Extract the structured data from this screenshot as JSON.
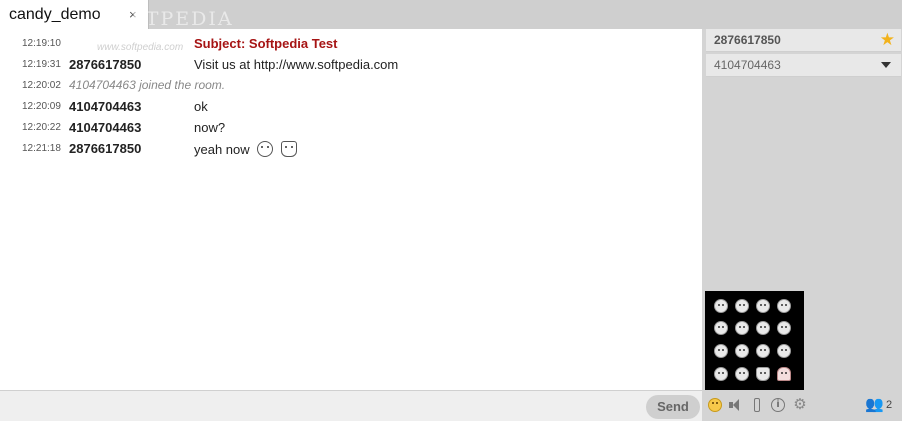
{
  "tab": {
    "label": "candy_demo",
    "close": "×",
    "watermark": "SOFTPEDIA"
  },
  "messages": [
    {
      "time": "12:19:10",
      "kind": "subject",
      "user": "",
      "text": "Subject: Softpedia Test",
      "watermark": "www.softpedia.com"
    },
    {
      "time": "12:19:31",
      "kind": "message",
      "user": "2876617850",
      "text": "Visit us at http://www.softpedia.com"
    },
    {
      "time": "12:20:02",
      "kind": "info",
      "user": "",
      "text": "4104704463 joined the room."
    },
    {
      "time": "12:20:09",
      "kind": "message",
      "user": "4104704463",
      "text": "ok"
    },
    {
      "time": "12:20:22",
      "kind": "message",
      "user": "4104704463",
      "text": "now?"
    },
    {
      "time": "12:21:18",
      "kind": "message",
      "user": "2876617850",
      "text": "yeah now",
      "emoticons": [
        "smile-icon",
        "cat-icon"
      ]
    }
  ],
  "input": {
    "send_label": "Send"
  },
  "roster": [
    {
      "name": "2876617850",
      "icon": "star-icon",
      "color": "#f2b21b"
    },
    {
      "name": "4104704463",
      "icon": "caret-down-icon"
    }
  ],
  "toolbar": {
    "icons": [
      "emoticons-icon",
      "sound-icon",
      "autoscroll-icon",
      "status-message-icon",
      "settings-icon",
      "users-icon"
    ],
    "user_count": "2"
  },
  "emoticon_picker": {
    "icons": [
      "smile-icon",
      "wink-icon",
      "grin-icon",
      "happy-icon",
      "sad-icon",
      "angry-icon",
      "surprised-icon",
      "tongue-icon",
      "neutral-icon",
      "laugh-icon",
      "cool-icon",
      "shock-icon",
      "glasses-icon",
      "innocent-icon",
      "devil-icon",
      "heart-icon"
    ]
  },
  "colors": {
    "subject": "#a61414",
    "accent_star": "#f2b21b",
    "roster_bg": "#d4d4d4"
  }
}
